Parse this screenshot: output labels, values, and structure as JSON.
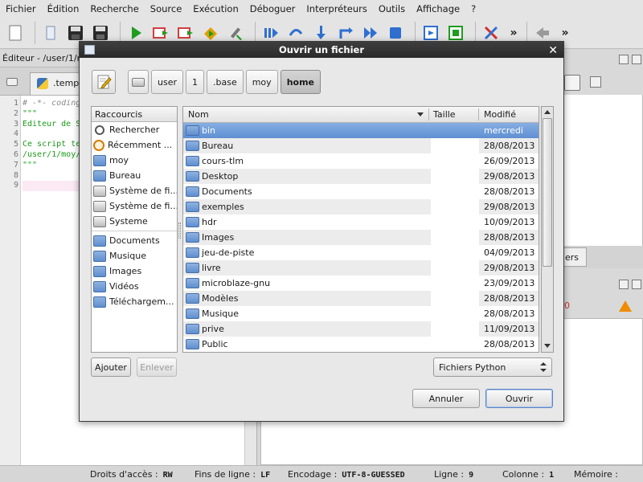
{
  "menu": [
    {
      "id": "fichier",
      "label": "Fichier"
    },
    {
      "id": "edition",
      "label": "Édition"
    },
    {
      "id": "recherche",
      "label": "Recherche"
    },
    {
      "id": "source",
      "label": "Source"
    },
    {
      "id": "execution",
      "label": "Exécution"
    },
    {
      "id": "deboguer",
      "label": "Déboguer"
    },
    {
      "id": "interpreteurs",
      "label": "Interpréteurs"
    },
    {
      "id": "outils",
      "label": "Outils"
    },
    {
      "id": "affichage",
      "label": "Affichage"
    },
    {
      "id": "aide",
      "label": "?"
    }
  ],
  "toolbar": {
    "more_label": "»",
    "more_label_2": "»",
    "colors": {
      "run": "#1f9d1f",
      "debug": "#2f6fd0",
      "stop": "#e0a000"
    }
  },
  "editor": {
    "header": "Éditeur - /user/1/m",
    "tab_label": ".temp",
    "line_numbers": [
      "1",
      "2",
      "3",
      "4",
      "5",
      "6",
      "7",
      "8",
      "9"
    ],
    "lines": [
      "# -*- coding",
      "\"\"\"",
      "Éditeur de S",
      "",
      "Ce script te",
      "/user/1/moy/",
      "\"\"\"",
      "",
      ""
    ]
  },
  "right_pane": {
    "mid_tab_label": "ers",
    "bottom_counter": "0"
  },
  "status": {
    "access_label": "Droits d'accès :",
    "access_value": "RW",
    "eol_label": "Fins de ligne :",
    "eol_value": "LF",
    "encoding_label": "Encodage :",
    "encoding_value": "UTF-8-GUESSED",
    "line_label": "Ligne :",
    "line_value": "9",
    "column_label": "Colonne :",
    "column_value": "1",
    "memory_label": "Mémoire :"
  },
  "dialog": {
    "title": "Ouvrir un fichier",
    "close_glyph": "✕",
    "breadcrumbs": [
      "user",
      "1",
      ".base",
      "moy",
      "home"
    ],
    "active_crumb": "home",
    "places_header": "Raccourcis",
    "places": [
      {
        "label": "Rechercher",
        "icon": "search-icon"
      },
      {
        "label": "Récemment ...",
        "icon": "recent-icon"
      },
      {
        "label": "moy",
        "icon": "home-folder-icon"
      },
      {
        "label": "Bureau",
        "icon": "desktop-folder-icon"
      },
      {
        "label": "Système de fi...",
        "icon": "drive-icon"
      },
      {
        "label": "Système de fi...",
        "icon": "drive-icon"
      },
      {
        "label": "Systeme",
        "icon": "drive-icon"
      }
    ],
    "bookmarks": [
      {
        "label": "Documents",
        "icon": "folder-icon"
      },
      {
        "label": "Musique",
        "icon": "folder-icon"
      },
      {
        "label": "Images",
        "icon": "folder-icon"
      },
      {
        "label": "Vidéos",
        "icon": "folder-icon"
      },
      {
        "label": "Téléchargem...",
        "icon": "folder-icon"
      }
    ],
    "columns": {
      "name": "Nom",
      "size": "Taille",
      "modified": "Modifié"
    },
    "files": [
      {
        "name": "bin",
        "size": "",
        "modified": "mercredi",
        "selected": true
      },
      {
        "name": "Bureau",
        "size": "",
        "modified": "28/08/2013"
      },
      {
        "name": "cours-tlm",
        "size": "",
        "modified": "26/09/2013"
      },
      {
        "name": "Desktop",
        "size": "",
        "modified": "29/08/2013"
      },
      {
        "name": "Documents",
        "size": "",
        "modified": "28/08/2013"
      },
      {
        "name": "exemples",
        "size": "",
        "modified": "29/08/2013"
      },
      {
        "name": "hdr",
        "size": "",
        "modified": "10/09/2013"
      },
      {
        "name": "Images",
        "size": "",
        "modified": "28/08/2013"
      },
      {
        "name": "jeu-de-piste",
        "size": "",
        "modified": "04/09/2013"
      },
      {
        "name": "livre",
        "size": "",
        "modified": "29/08/2013"
      },
      {
        "name": "microblaze-gnu",
        "size": "",
        "modified": "23/09/2013"
      },
      {
        "name": "Modèles",
        "size": "",
        "modified": "28/08/2013"
      },
      {
        "name": "Musique",
        "size": "",
        "modified": "28/08/2013"
      },
      {
        "name": "prive",
        "size": "",
        "modified": "11/09/2013"
      },
      {
        "name": "Public",
        "size": "",
        "modified": "28/08/2013"
      }
    ],
    "add_button": "Ajouter",
    "remove_button": "Enlever",
    "filter_value": "Fichiers Python",
    "cancel_button": "Annuler",
    "open_button": "Ouvrir",
    "colors": {
      "selection": "#6d99d8",
      "folder": "#6f9bd6"
    }
  }
}
